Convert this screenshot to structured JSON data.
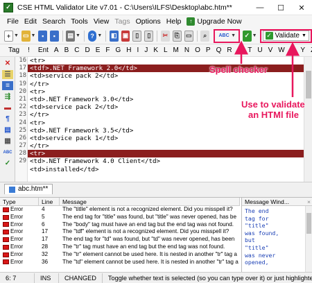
{
  "window": {
    "app_icon": "app-logo-icon",
    "title": "CSE HTML Validator Lite v7.01 - C:\\Users\\ILFS\\Desktop\\abc.htm**",
    "minimize": "—",
    "maximize": "☐",
    "close": "✕"
  },
  "menu": {
    "items": [
      "File",
      "Edit",
      "Search",
      "Tools",
      "View",
      "Tags",
      "Options",
      "Help"
    ],
    "upgrade_label": "Upgrade Now"
  },
  "toolbar": {
    "validate_label": "Validate",
    "spell_label": "ABC"
  },
  "tagbar": {
    "items": [
      "Tag",
      "!",
      "Ent",
      "A",
      "B",
      "C",
      "D",
      "E",
      "F",
      "G",
      "H",
      "I",
      "J",
      "K",
      "L",
      "M",
      "N",
      "O",
      "P",
      "Q",
      "R",
      "S",
      "T",
      "U",
      "V",
      "W",
      "X",
      "Y",
      "Z"
    ]
  },
  "editor": {
    "line_numbers": [
      "16",
      "17",
      "18",
      "19",
      "20",
      "21",
      "22",
      "23",
      "24",
      "25",
      "26",
      "27",
      "28",
      "29"
    ],
    "lines": [
      "<tr>",
      "<tdf>.NET Framework 2.0</td>",
      "<td>service pack 2</td>",
      "</tr>",
      "<tr>",
      "<td>.NET Framework 3.0</td>",
      "<td>service pack 2</td>",
      "</tr>",
      "<tr>",
      "<td>.NET Framework 3.5</td>",
      "<td>service pack 1</td>",
      "</tr>",
      "<tr>",
      "<td>.NET Framework 4.0 Client</td>",
      "<td>installed</td>"
    ],
    "highlighted": [
      1,
      12
    ]
  },
  "tabs": {
    "file_tab": "abc.htm**"
  },
  "messages": {
    "headers": {
      "type": "Type",
      "line": "Line",
      "message": "Message"
    },
    "rows": [
      {
        "type": "Error",
        "line": "4",
        "message": "The \"titlle\" element is not a recognized element. Did you misspell it?"
      },
      {
        "type": "Error",
        "line": "5",
        "message": "The end tag for \"title\" was found, but \"title\" was never opened, has be"
      },
      {
        "type": "Error",
        "line": "6",
        "message": "The \"body\" tag must have an end tag but the end tag was not found."
      },
      {
        "type": "Error",
        "line": "17",
        "message": "The \"tdf\" element is not a recognized element. Did you misspell it?"
      },
      {
        "type": "Error",
        "line": "17",
        "message": "The end tag for \"td\" was found, but \"td\" was never opened, has been"
      },
      {
        "type": "Error",
        "line": "28",
        "message": "The \"tr\" tag must have an end tag but the end tag was not found."
      },
      {
        "type": "Error",
        "line": "32",
        "message": "The \"tr\" element cannot be used here. It is nested in another \"tr\" tag a"
      },
      {
        "type": "Error",
        "line": "36",
        "message": "The \"td\" element cannot be used here. It is nested in another \"tr\" tag a"
      }
    ]
  },
  "message_window": {
    "title": "Message Wind...",
    "text": "The end\ntag for\n\"title\"\nwas found,\nbut\n\"title\"\nwas never\nopened,"
  },
  "status": {
    "position": "6: 7",
    "mode": "INS",
    "state": "CHANGED",
    "hint": "Toggle whether text is selected (so you can type over it) or just highlighted."
  },
  "annotations": {
    "spell": "Spell checker",
    "validate_line1": "Use to validate",
    "validate_line2": "an HTMl file"
  },
  "colors": {
    "highlight_row": "#8b1e1e",
    "annotation": "#e8175d",
    "error_icon": "#d81818",
    "message_text": "#1a3fb5"
  }
}
